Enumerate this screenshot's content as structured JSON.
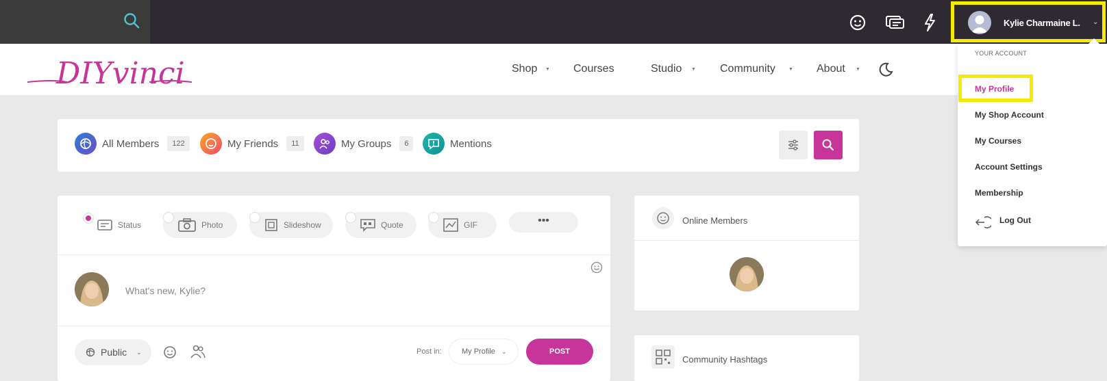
{
  "account": {
    "name": "Kylie Charmaine L.",
    "menu_heading": "YOUR ACCOUNT",
    "menu_items": [
      {
        "label": "My Profile"
      },
      {
        "label": "My Shop Account"
      },
      {
        "label": "My Courses"
      },
      {
        "label": "Account Settings"
      },
      {
        "label": "Membership"
      },
      {
        "label": "Log Out"
      }
    ]
  },
  "nav": {
    "items": [
      {
        "label": "Shop"
      },
      {
        "label": "Courses"
      },
      {
        "label": "Studio"
      },
      {
        "label": "Community"
      },
      {
        "label": "About"
      }
    ]
  },
  "brand": {
    "logo_text": "DIYvinci",
    "accent": "#c7359a",
    "highlight": "#f4ec00"
  },
  "subnav": {
    "items": [
      {
        "label": "All Members",
        "count": "122"
      },
      {
        "label": "My Friends",
        "count": "11"
      },
      {
        "label": "My Groups",
        "count": "6"
      },
      {
        "label": "Mentions",
        "count": ""
      }
    ]
  },
  "post": {
    "types": [
      {
        "label": "Status"
      },
      {
        "label": "Photo"
      },
      {
        "label": "Slideshow"
      },
      {
        "label": "Quote"
      },
      {
        "label": "GIF"
      }
    ],
    "more_label": "•••",
    "placeholder": "What's new, Kylie?",
    "privacy": "Public",
    "post_in_label": "Post in:",
    "post_in_value": "My Profile",
    "submit_label": "POST"
  },
  "widgets": {
    "online_title": "Online Members",
    "hashtags_title": "Community Hashtags"
  }
}
